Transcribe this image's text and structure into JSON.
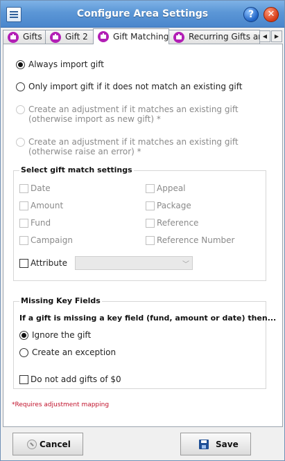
{
  "window": {
    "title": "Configure Area Settings",
    "help_glyph": "?",
    "close_glyph": "✕"
  },
  "tabs": [
    {
      "label": "Gifts",
      "active": false
    },
    {
      "label": "Gift 2",
      "active": false
    },
    {
      "label": "Gift Matching",
      "active": true
    },
    {
      "label": "Recurring Gifts and",
      "active": false
    }
  ],
  "tab_scroll": {
    "left": "◀",
    "right": "▶"
  },
  "import_options": [
    {
      "label": "Always import gift",
      "checked": true,
      "enabled": true
    },
    {
      "label": "Only import gift if it does not match an existing gift",
      "checked": false,
      "enabled": true
    },
    {
      "line1": "Create an adjustment if it matches an existing gift",
      "line2": "(otherwise import as new gift) *",
      "checked": false,
      "enabled": false
    },
    {
      "line1": "Create an adjustment if it matches an existing gift",
      "line2": "(otherwise raise an error) *",
      "checked": false,
      "enabled": false
    }
  ],
  "match_settings": {
    "title": "Select gift match settings",
    "fields": [
      "Date",
      "Amount",
      "Fund",
      "Campaign",
      "Appeal",
      "Package",
      "Reference",
      "Reference Number"
    ],
    "attribute_label": "Attribute",
    "attribute_value": ""
  },
  "missing_key": {
    "title": "Missing Key Fields",
    "prompt": "If a gift is missing a key field (fund, amount or date) then...",
    "options": [
      {
        "label": "Ignore the gift",
        "checked": true
      },
      {
        "label": "Create an exception",
        "checked": false
      }
    ],
    "zero_label": "Do not add gifts of $0"
  },
  "footnote": "*Requires adjustment mapping",
  "buttons": {
    "cancel": "Cancel",
    "save": "Save"
  },
  "colors": {
    "titlebar": "#5b96d6",
    "tab_icon": "#b21fb5",
    "footnote": "#c0102a"
  }
}
